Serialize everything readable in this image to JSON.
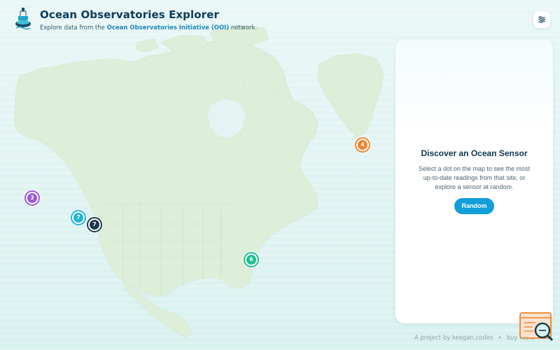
{
  "app": {
    "title": "Ocean Observatories Explorer",
    "subtitle_prefix": "Explore data from the ",
    "subtitle_link": "Ocean Observatories Initiative (OOI)",
    "subtitle_suffix": " network."
  },
  "panel": {
    "title": "Discover an Ocean Sensor",
    "description": "Select a dot on the map to see the most up-to-date readings from that site, or explore a sensor at random.",
    "random_label": "Random"
  },
  "markers": [
    {
      "label": "3",
      "color": "#9b59d9"
    },
    {
      "label": "7",
      "color": "#1fb7d4"
    },
    {
      "label": "7",
      "color": "#1f3a4d"
    },
    {
      "label": "4",
      "color": "#f0832b"
    },
    {
      "label": "6",
      "color": "#1fbf90"
    }
  ],
  "footer": {
    "credit": "A project by keegan.codes",
    "separator": "•",
    "extra": "buy me a"
  },
  "colors": {
    "accent": "#129ed8",
    "title": "#0a3b5a",
    "land": "#ddefd9"
  },
  "icons": {
    "settings": "sliders-icon",
    "logo": "buoy-icon",
    "help": "chat-search-icon"
  }
}
